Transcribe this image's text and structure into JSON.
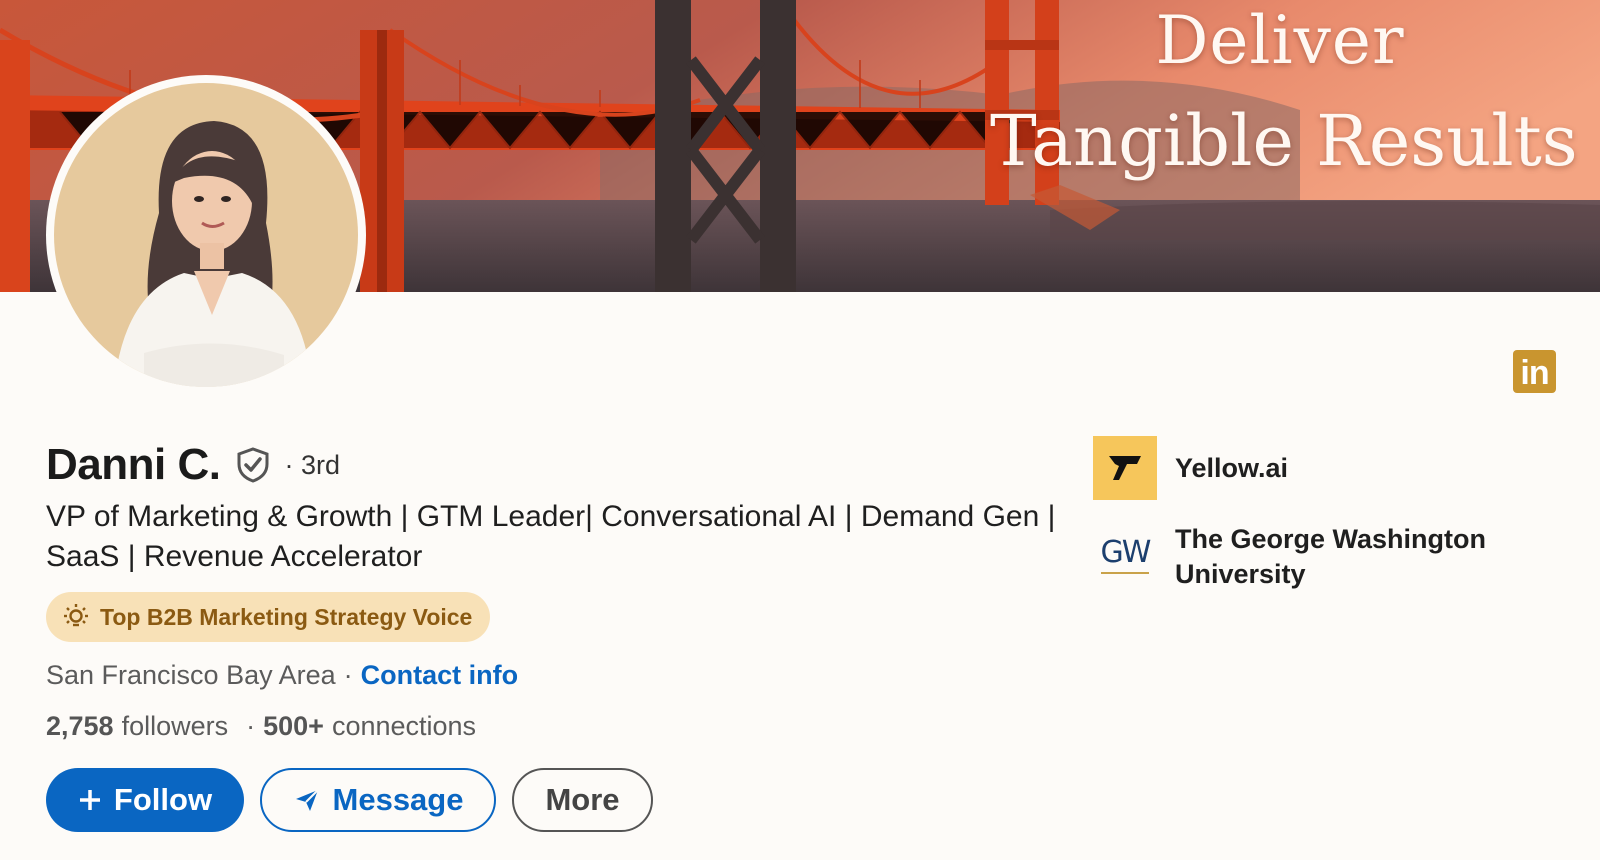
{
  "banner": {
    "line1": "Deliver",
    "line2": "Tangible Results"
  },
  "profile": {
    "name": "Danni C.",
    "degree": "· 3rd",
    "headline": "VP of Marketing & Growth | GTM Leader| Conversational AI | Demand Gen | SaaS | Revenue Accelerator",
    "badge": "Top B2B Marketing Strategy Voice",
    "location": "San Francisco Bay Area",
    "location_sep": "·",
    "contact_info": "Contact info",
    "followers_count": "2,758",
    "followers_label": "followers",
    "connections_sep": "·",
    "connections_count": "500+",
    "connections_label": "connections"
  },
  "actions": {
    "follow": "Follow",
    "message": "Message",
    "more": "More"
  },
  "affiliations": [
    {
      "name": "Yellow.ai",
      "logo": "yellow-ai-logo"
    },
    {
      "name": "The George Washington University",
      "logo_text": "GW"
    }
  ],
  "logo": {
    "linkedin": "in"
  },
  "colors": {
    "brand_blue": "#0a66c2",
    "badge_bg": "#f8e1b7",
    "badge_text": "#8b5a12",
    "linkedin_logo": "#c9952f",
    "yellow_ai_bg": "#f6c65b"
  },
  "icons": [
    "verified-shield-icon",
    "lightbulb-icon",
    "plus-icon",
    "send-icon",
    "linkedin-icon"
  ]
}
